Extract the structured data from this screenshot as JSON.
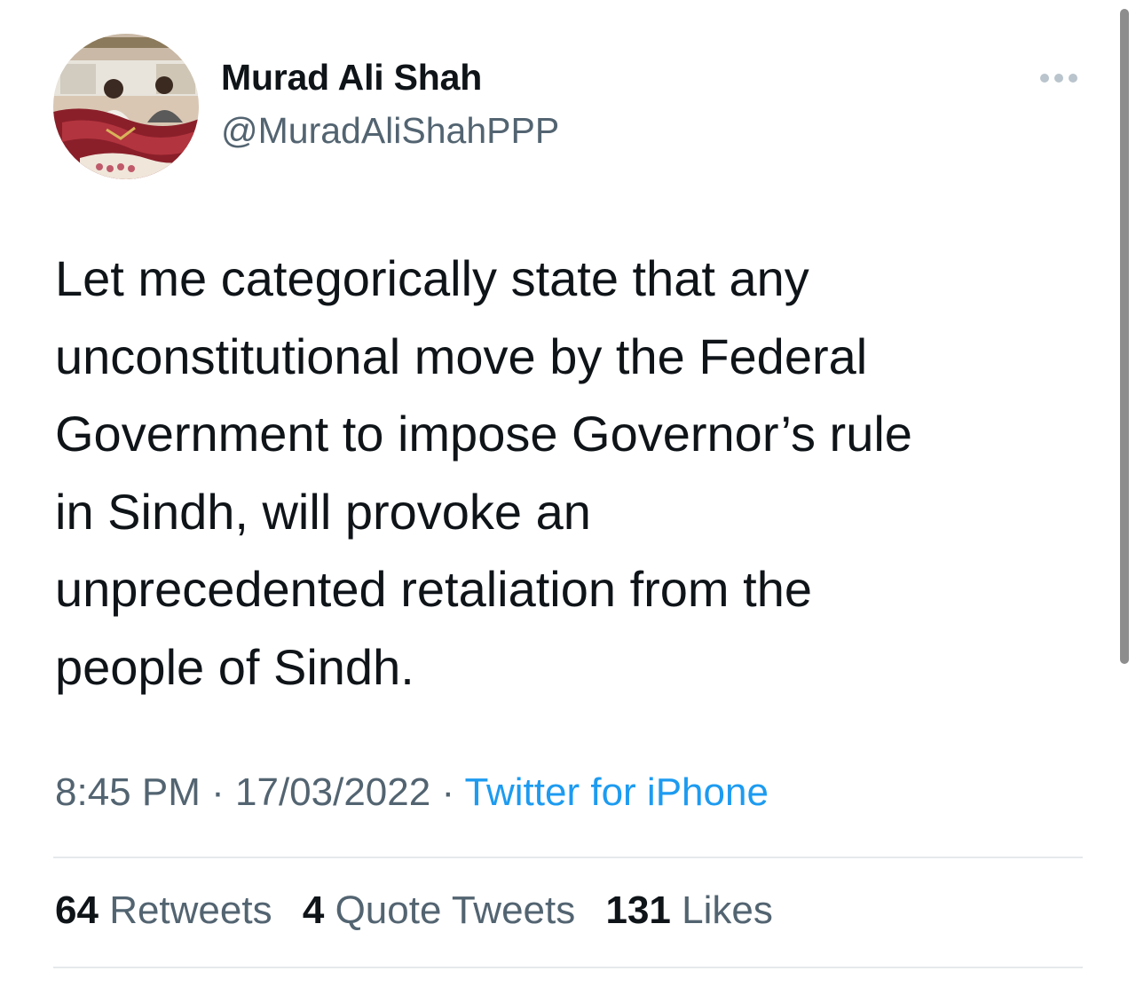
{
  "tweet": {
    "author": {
      "display_name": "Murad Ali Shah",
      "handle": "@MuradAliShahPPP"
    },
    "more_icon": "more-horizontal-icon",
    "text_lines": [
      "Let me categorically state that any",
      "unconstitutional move by the Federal",
      "Government to impose Governor’s rule",
      "in Sindh, will provoke an",
      "unprecedented retaliation from the",
      "people of Sindh."
    ],
    "meta": {
      "time": "8:45 PM",
      "separator": "·",
      "date": "17/03/2022",
      "source": "Twitter for iPhone"
    },
    "stats": {
      "retweets": {
        "count": "64",
        "label": "Retweets"
      },
      "quote_tweets": {
        "count": "4",
        "label": "Quote Tweets"
      },
      "likes": {
        "count": "131",
        "label": "Likes"
      }
    }
  },
  "colors": {
    "text_primary": "#0f1419",
    "text_secondary": "#536471",
    "link": "#1d9bf0",
    "divider": "#e6e9eb",
    "more_dots": "#b9c4cc",
    "scrollbar": "#8d8d8d"
  }
}
